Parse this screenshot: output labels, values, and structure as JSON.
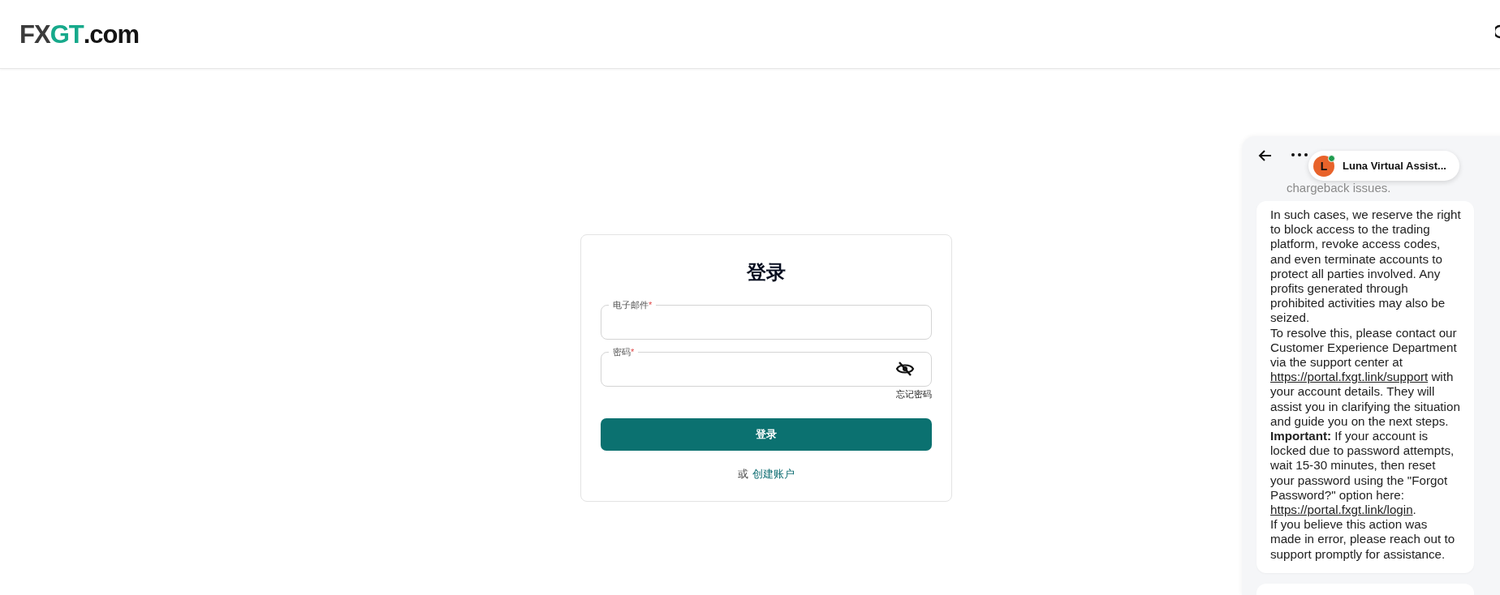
{
  "header": {
    "logo": {
      "parts": [
        {
          "text": "FX",
          "color": "#3b3b3b"
        },
        {
          "text": "GT",
          "color": "#17a98b"
        },
        {
          "text": ".com",
          "color": "#141414"
        }
      ]
    }
  },
  "login": {
    "title": "登录",
    "fields": [
      {
        "label": "电子邮件",
        "required_mark": "*",
        "kind": "text"
      },
      {
        "label": "密码",
        "required_mark": "*",
        "kind": "password"
      }
    ],
    "forgot_link": "忘记密码",
    "submit": "登录",
    "alt_prefix": "或",
    "signup_link": "创建账户"
  },
  "chat": {
    "agent": {
      "initial": "L",
      "name": "Luna Virtual Assist...",
      "online": true
    },
    "faded_text": "chargeback issues.",
    "paragraphs": [
      [
        {
          "kind": "text",
          "text": "In such cases, we reserve the right to block access to the trading platform, revoke access codes, and even terminate accounts to protect all parties involved. Any profits generated through prohibited activities may also be seized."
        }
      ],
      [
        {
          "kind": "text",
          "text": "To resolve this, please contact our Customer Experience Department via the support center at "
        },
        {
          "kind": "link",
          "text": "https://portal.fxgt.link/support"
        },
        {
          "kind": "text",
          "text": " with your account details. They will assist you in clarifying the situation and guide you on the next steps."
        }
      ],
      [
        {
          "kind": "text",
          "text": "**Important:** If your account is locked due to password attempts, wait 15-30 minutes, then reset your password using the \"Forgot Password?\" option here: "
        },
        {
          "kind": "link",
          "text": "https://portal.fxgt.link/login"
        },
        {
          "kind": "text",
          "text": "."
        }
      ],
      [
        {
          "kind": "text",
          "text": "If you believe this action was made in error, please reach out to support promptly for assistance."
        }
      ]
    ]
  }
}
